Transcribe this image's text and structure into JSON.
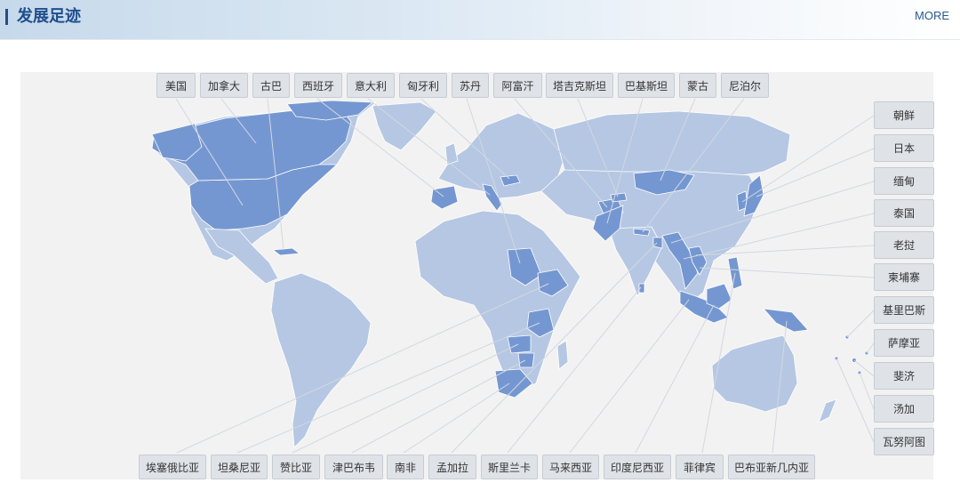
{
  "header": {
    "title": "发展足迹",
    "more_label": "MORE"
  },
  "colors": {
    "accent": "#1f4e8c",
    "map_base": "#b5c7e3",
    "map_highlight": "#7597d1",
    "panel_bg": "#f2f2f2"
  },
  "countries_top": [
    "美国",
    "加拿大",
    "古巴",
    "西班牙",
    "意大利",
    "匈牙利",
    "苏丹",
    "阿富汗",
    "塔吉克斯坦",
    "巴基斯坦",
    "蒙古",
    "尼泊尔"
  ],
  "countries_right": [
    "朝鲜",
    "日本",
    "缅甸",
    "泰国",
    "老挝",
    "柬埔寨",
    "基里巴斯",
    "萨摩亚",
    "斐济",
    "汤加",
    "瓦努阿图"
  ],
  "countries_bottom": [
    "埃塞俄比亚",
    "坦桑尼亚",
    "赞比亚",
    "津巴布韦",
    "南非",
    "孟加拉",
    "斯里兰卡",
    "马来西亚",
    "印度尼西亚",
    "菲律宾",
    "巴布亚新几内亚"
  ]
}
